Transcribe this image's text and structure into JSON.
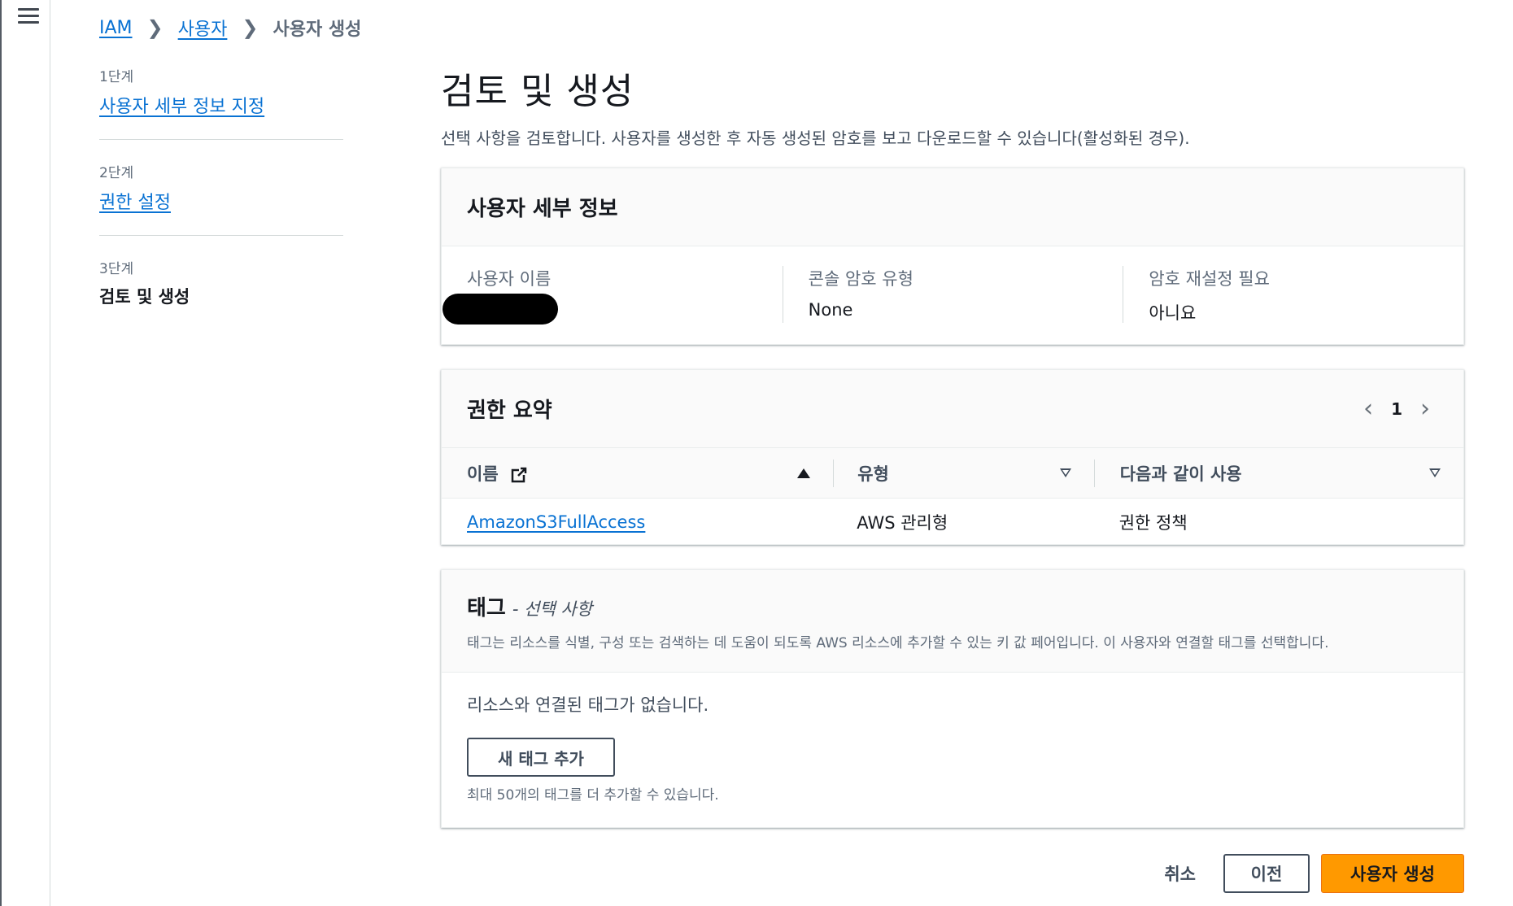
{
  "nav": {
    "menu_icon": "hamburger-menu-icon"
  },
  "breadcrumb": {
    "items": [
      {
        "label": "IAM"
      },
      {
        "label": "사용자"
      }
    ],
    "current": "사용자 생성",
    "separator_icon": "chevron-right-icon"
  },
  "steps": [
    {
      "number": "1단계",
      "label": "사용자 세부 정보 지정"
    },
    {
      "number": "2단계",
      "label": "권한 설정"
    },
    {
      "number": "3단계",
      "label": "검토 및 생성"
    }
  ],
  "page": {
    "title": "검토 및 생성",
    "description": "선택 사항을 검토합니다. 사용자를 생성한 후 자동 생성된 암호를 보고 다운로드할 수 있습니다(활성화된 경우)."
  },
  "user_details": {
    "title": "사용자 세부 정보",
    "fields": [
      {
        "label": "사용자 이름",
        "value": ""
      },
      {
        "label": "콘솔 암호 유형",
        "value": "None"
      },
      {
        "label": "암호 재설정 필요",
        "value": "아니요"
      }
    ]
  },
  "permissions": {
    "title": "권한 요약",
    "page_number": "1",
    "columns": [
      "이름",
      "유형",
      "다음과 같이 사용"
    ],
    "rows": [
      {
        "name": "AmazonS3FullAccess",
        "type": "AWS 관리형",
        "used_as": "권한 정책"
      }
    ]
  },
  "tags": {
    "title": "태그",
    "optional": "- 선택 사항",
    "description": "태그는 리소스를 식별, 구성 또는 검색하는 데 도움이 되도록 AWS 리소스에 추가할 수 있는 키 값 페어입니다. 이 사용자와 연결할 태그를 선택합니다.",
    "empty_text": "리소스와 연결된 태그가 없습니다.",
    "add_button": "새 태그 추가",
    "limit_text": "최대 50개의 태그를 더 추가할 수 있습니다."
  },
  "actions": {
    "cancel": "취소",
    "previous": "이전",
    "create": "사용자 생성"
  },
  "colors": {
    "link": "#0972d3",
    "primary_button": "#ff9900",
    "text": "#16191f"
  }
}
